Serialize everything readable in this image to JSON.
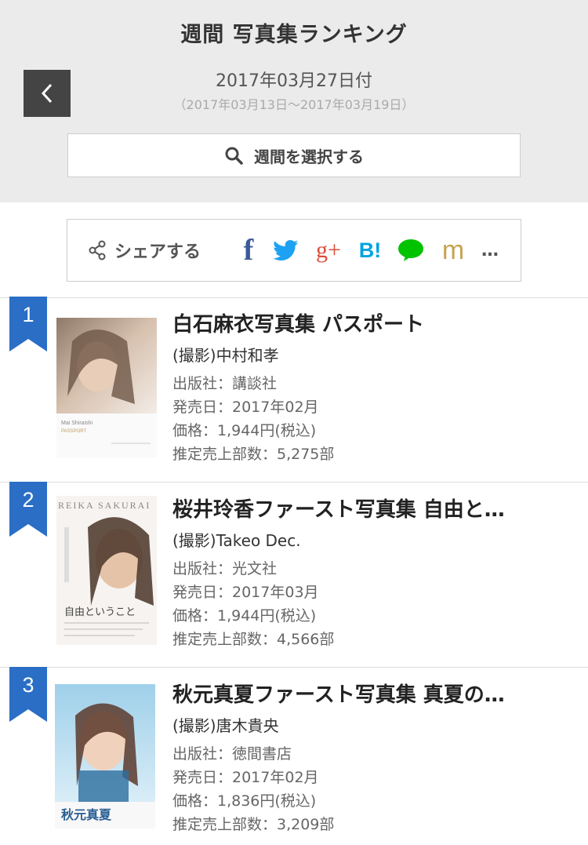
{
  "header": {
    "title": "週間 写真集ランキング",
    "date": "2017年03月27日付",
    "range": "（2017年03月13日〜2017年03月19日）",
    "week_select": "週間を選択する"
  },
  "share": {
    "label": "シェアする",
    "facebook": "f",
    "googleplus": "g+",
    "hatena": "B!",
    "mixi": "m",
    "more": "…"
  },
  "colors": {
    "ribbon": "#2a6ec6",
    "header_bg": "#ebebeb",
    "back_button": "#444444",
    "facebook": "#3b5998",
    "twitter": "#1da1f2",
    "googleplus": "#dd4b39",
    "hatena": "#00a4de",
    "line": "#00c300",
    "mixi": "#c7a350"
  },
  "items": [
    {
      "rank": "1",
      "title": "白石麻衣写真集 パスポート",
      "photographer": "(撮影)中村和孝",
      "publisher": "出版社：講談社",
      "release": "発売日：2017年02月",
      "price": "価格：1,944円(税込)",
      "sales": "推定売上部数：5,275部",
      "cover_text": "Mai Shiraishi\nPASSPORT"
    },
    {
      "rank": "2",
      "title": "桜井玲香ファースト写真集 自由と…",
      "photographer": "(撮影)Takeo Dec.",
      "publisher": "出版社：光文社",
      "release": "発売日：2017年03月",
      "price": "価格：1,944円(税込)",
      "sales": "推定売上部数：4,566部",
      "cover_text": "REIKA SAKURAI"
    },
    {
      "rank": "3",
      "title": "秋元真夏ファースト写真集 真夏の…",
      "photographer": "(撮影)唐木貴央",
      "publisher": "出版社：徳間書店",
      "release": "発売日：2017年02月",
      "price": "価格：1,836円(税込)",
      "sales": "推定売上部数：3,209部",
      "cover_text": "秋元真夏"
    }
  ]
}
